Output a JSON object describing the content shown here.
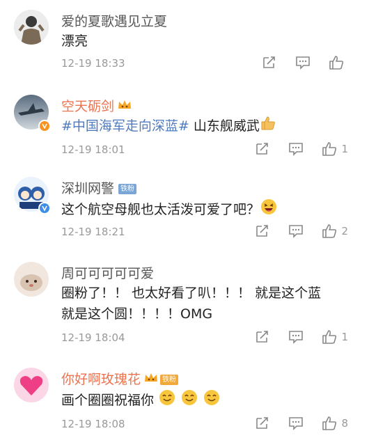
{
  "comments": [
    {
      "user": "爱的夏歌遇见立夏",
      "text": "漂亮",
      "time": "12-19 18:33",
      "likes": ""
    },
    {
      "user": "空天砺剑",
      "topic": "#中国海军走向深蓝#",
      "text": " 山东舰威武",
      "time": "12-19 18:01",
      "likes": "1"
    },
    {
      "user": "深圳网警",
      "badge": "铁粉",
      "text": "这个航空母舰也太活泼可爱了吧？",
      "time": "12-19 18:21",
      "likes": "2"
    },
    {
      "user": "周可可可可可爱",
      "text_line1": "圈粉了！！ 也太好看了叭！！！ 就是这个蓝",
      "text_line2": "就是这个圆！！！！OMG",
      "time": "12-19 18:04",
      "likes": "1"
    },
    {
      "user": "你好啊玫瑰花",
      "badge": "铁粉",
      "text": "画个圈圈祝福你",
      "time": "12-19 18:08",
      "likes": "8"
    }
  ],
  "icons": {
    "share": "share-icon",
    "reply": "comment-icon",
    "like": "thumbs-up-icon",
    "verified": "verified-badge-icon",
    "fan": "fan-crown-icon"
  },
  "colors": {
    "orange_name": "#eb7350",
    "topic_blue": "#4e7bbf",
    "meta_gray": "#999999"
  }
}
